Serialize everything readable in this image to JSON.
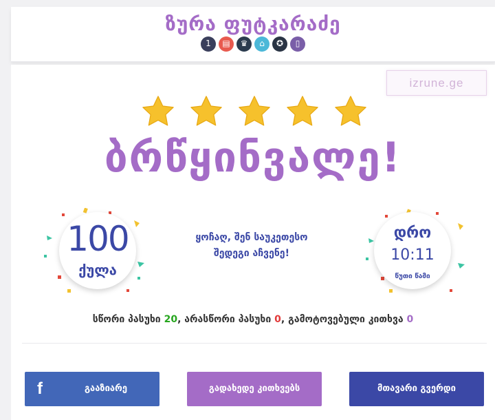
{
  "header": {
    "title": "ზურა ფუტკარაძე",
    "badges": [
      {
        "name": "medal-number-badge-icon",
        "color": "#3a3f5c",
        "glyph": "1"
      },
      {
        "name": "book-badge-icon",
        "color": "#e85a4f",
        "glyph": "▤"
      },
      {
        "name": "trophy-badge-icon",
        "color": "#2b3b4e",
        "glyph": "♛"
      },
      {
        "name": "graduation-cap-badge-icon",
        "color": "#4cb8d8",
        "glyph": "⌂"
      },
      {
        "name": "medal-badge-icon",
        "color": "#2a3444",
        "glyph": "✪"
      },
      {
        "name": "scroll-badge-icon",
        "color": "#7a5ea8",
        "glyph": "▯"
      }
    ]
  },
  "watermark": "izrune.ge",
  "rating": {
    "stars": 5,
    "max": 5,
    "star_color": "#f6c12c"
  },
  "result_title": "ბრწყინვალე!",
  "score": {
    "value": "100",
    "label": "ქულა"
  },
  "message": {
    "line1": "ყოჩაღ, შენ საუკეთესო",
    "line2": "შედეგი აჩვენე!"
  },
  "time": {
    "label": "დრო",
    "value": "10:11",
    "unit": "წუთი წამი"
  },
  "stats": {
    "correct_label": "სწორი პასუხი",
    "correct_value": "20",
    "wrong_label": "არასწორი პასუხი",
    "wrong_value": "0",
    "skipped_label": "გამოტოვებული კითხვა",
    "skipped_value": "0"
  },
  "buttons": {
    "share": "გააზიარე",
    "review": "გადახედე კითხვებს",
    "home": "მთავარი გვერდი"
  },
  "colors": {
    "accent_purple": "#a46cc7",
    "accent_blue": "#3b48a6",
    "facebook_blue": "#4267b8",
    "correct_green": "#27a61f",
    "wrong_red": "#e23a3a"
  }
}
